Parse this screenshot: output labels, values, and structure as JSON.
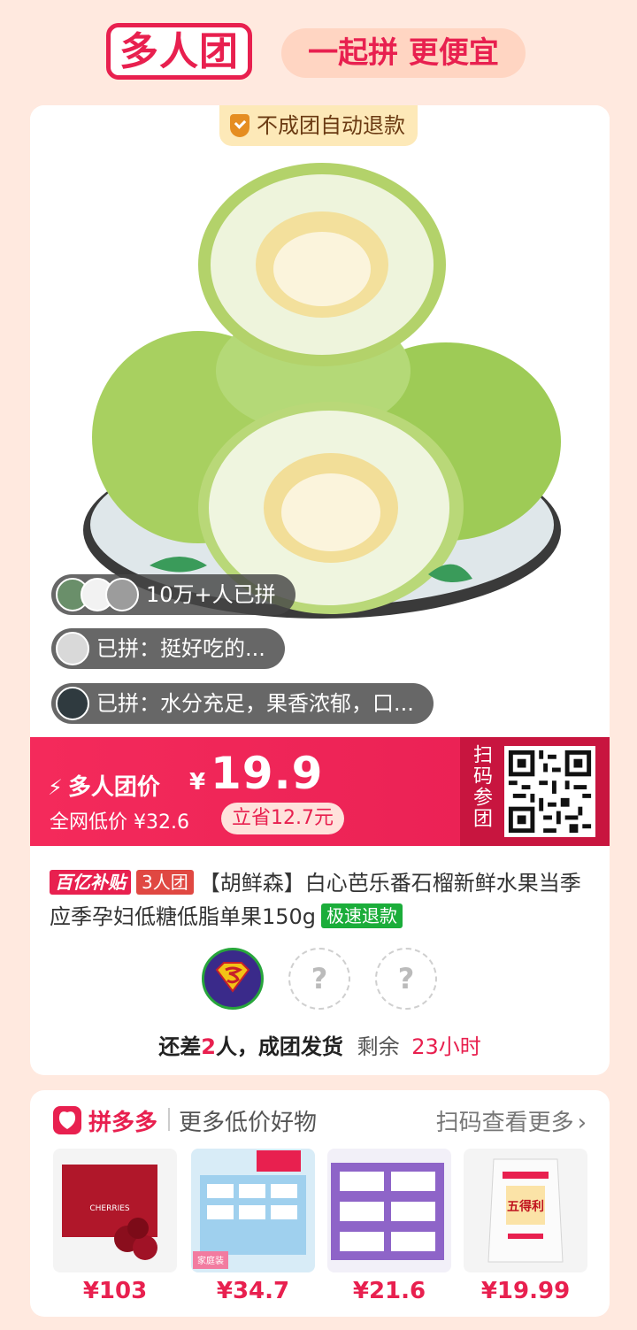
{
  "header": {
    "logo": "多人团",
    "slogan": "一起拼 更便宜"
  },
  "product": {
    "refund_badge": "不成团自动退款",
    "bubbles": [
      {
        "text": "10万+人已拼"
      },
      {
        "text": "已拼：挺好吃的..."
      },
      {
        "text": "已拼：水分充足，果香浓郁，口..."
      }
    ],
    "price": {
      "label": "多人团价",
      "currency": "¥",
      "value": "19.9",
      "net_low": "全网低价 ¥32.6",
      "save": "立省12.7元",
      "scan_label": "扫码参团"
    },
    "tags": {
      "subsidy": "百亿补贴",
      "group": "3人团",
      "refund": "极速退款"
    },
    "title": "【胡鲜森】白心芭乐番石榴新鲜水果当季应季孕妇低糖低脂单果150g",
    "members": {
      "empty_mark": "?"
    },
    "status": {
      "prefix": "还差",
      "count": "2",
      "suffix": "人，成团发货",
      "remain_label": "剩余",
      "remain_time": "23小时"
    }
  },
  "more": {
    "brand": "拼多多",
    "subtitle": "更多低价好物",
    "link": "扫码查看更多",
    "goods": [
      {
        "price": "¥103"
      },
      {
        "price": "¥34.7"
      },
      {
        "price": "¥21.6"
      },
      {
        "price": "¥19.99"
      }
    ],
    "goods_text": {
      "cherries": "CHERRIES",
      "tissue_label": "家庭装",
      "rice_brand": "五得利"
    }
  },
  "colors": {
    "accent": "#e8204f",
    "green": "#1bad3a",
    "background": "#ffe9df"
  }
}
